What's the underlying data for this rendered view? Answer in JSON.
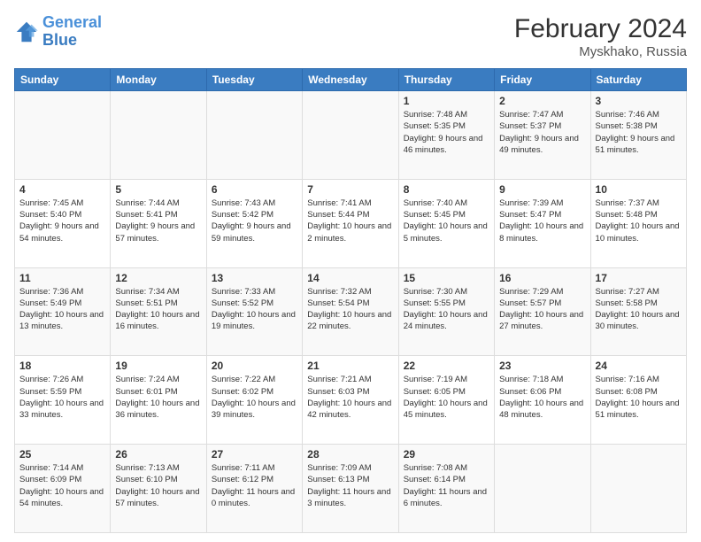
{
  "header": {
    "logo_general": "General",
    "logo_blue": "Blue",
    "title": "February 2024",
    "subtitle": "Myskhako, Russia"
  },
  "days_of_week": [
    "Sunday",
    "Monday",
    "Tuesday",
    "Wednesday",
    "Thursday",
    "Friday",
    "Saturday"
  ],
  "weeks": [
    [
      {
        "day": "",
        "info": ""
      },
      {
        "day": "",
        "info": ""
      },
      {
        "day": "",
        "info": ""
      },
      {
        "day": "",
        "info": ""
      },
      {
        "day": "1",
        "info": "Sunrise: 7:48 AM\nSunset: 5:35 PM\nDaylight: 9 hours and 46 minutes."
      },
      {
        "day": "2",
        "info": "Sunrise: 7:47 AM\nSunset: 5:37 PM\nDaylight: 9 hours and 49 minutes."
      },
      {
        "day": "3",
        "info": "Sunrise: 7:46 AM\nSunset: 5:38 PM\nDaylight: 9 hours and 51 minutes."
      }
    ],
    [
      {
        "day": "4",
        "info": "Sunrise: 7:45 AM\nSunset: 5:40 PM\nDaylight: 9 hours and 54 minutes."
      },
      {
        "day": "5",
        "info": "Sunrise: 7:44 AM\nSunset: 5:41 PM\nDaylight: 9 hours and 57 minutes."
      },
      {
        "day": "6",
        "info": "Sunrise: 7:43 AM\nSunset: 5:42 PM\nDaylight: 9 hours and 59 minutes."
      },
      {
        "day": "7",
        "info": "Sunrise: 7:41 AM\nSunset: 5:44 PM\nDaylight: 10 hours and 2 minutes."
      },
      {
        "day": "8",
        "info": "Sunrise: 7:40 AM\nSunset: 5:45 PM\nDaylight: 10 hours and 5 minutes."
      },
      {
        "day": "9",
        "info": "Sunrise: 7:39 AM\nSunset: 5:47 PM\nDaylight: 10 hours and 8 minutes."
      },
      {
        "day": "10",
        "info": "Sunrise: 7:37 AM\nSunset: 5:48 PM\nDaylight: 10 hours and 10 minutes."
      }
    ],
    [
      {
        "day": "11",
        "info": "Sunrise: 7:36 AM\nSunset: 5:49 PM\nDaylight: 10 hours and 13 minutes."
      },
      {
        "day": "12",
        "info": "Sunrise: 7:34 AM\nSunset: 5:51 PM\nDaylight: 10 hours and 16 minutes."
      },
      {
        "day": "13",
        "info": "Sunrise: 7:33 AM\nSunset: 5:52 PM\nDaylight: 10 hours and 19 minutes."
      },
      {
        "day": "14",
        "info": "Sunrise: 7:32 AM\nSunset: 5:54 PM\nDaylight: 10 hours and 22 minutes."
      },
      {
        "day": "15",
        "info": "Sunrise: 7:30 AM\nSunset: 5:55 PM\nDaylight: 10 hours and 24 minutes."
      },
      {
        "day": "16",
        "info": "Sunrise: 7:29 AM\nSunset: 5:57 PM\nDaylight: 10 hours and 27 minutes."
      },
      {
        "day": "17",
        "info": "Sunrise: 7:27 AM\nSunset: 5:58 PM\nDaylight: 10 hours and 30 minutes."
      }
    ],
    [
      {
        "day": "18",
        "info": "Sunrise: 7:26 AM\nSunset: 5:59 PM\nDaylight: 10 hours and 33 minutes."
      },
      {
        "day": "19",
        "info": "Sunrise: 7:24 AM\nSunset: 6:01 PM\nDaylight: 10 hours and 36 minutes."
      },
      {
        "day": "20",
        "info": "Sunrise: 7:22 AM\nSunset: 6:02 PM\nDaylight: 10 hours and 39 minutes."
      },
      {
        "day": "21",
        "info": "Sunrise: 7:21 AM\nSunset: 6:03 PM\nDaylight: 10 hours and 42 minutes."
      },
      {
        "day": "22",
        "info": "Sunrise: 7:19 AM\nSunset: 6:05 PM\nDaylight: 10 hours and 45 minutes."
      },
      {
        "day": "23",
        "info": "Sunrise: 7:18 AM\nSunset: 6:06 PM\nDaylight: 10 hours and 48 minutes."
      },
      {
        "day": "24",
        "info": "Sunrise: 7:16 AM\nSunset: 6:08 PM\nDaylight: 10 hours and 51 minutes."
      }
    ],
    [
      {
        "day": "25",
        "info": "Sunrise: 7:14 AM\nSunset: 6:09 PM\nDaylight: 10 hours and 54 minutes."
      },
      {
        "day": "26",
        "info": "Sunrise: 7:13 AM\nSunset: 6:10 PM\nDaylight: 10 hours and 57 minutes."
      },
      {
        "day": "27",
        "info": "Sunrise: 7:11 AM\nSunset: 6:12 PM\nDaylight: 11 hours and 0 minutes."
      },
      {
        "day": "28",
        "info": "Sunrise: 7:09 AM\nSunset: 6:13 PM\nDaylight: 11 hours and 3 minutes."
      },
      {
        "day": "29",
        "info": "Sunrise: 7:08 AM\nSunset: 6:14 PM\nDaylight: 11 hours and 6 minutes."
      },
      {
        "day": "",
        "info": ""
      },
      {
        "day": "",
        "info": ""
      }
    ]
  ]
}
